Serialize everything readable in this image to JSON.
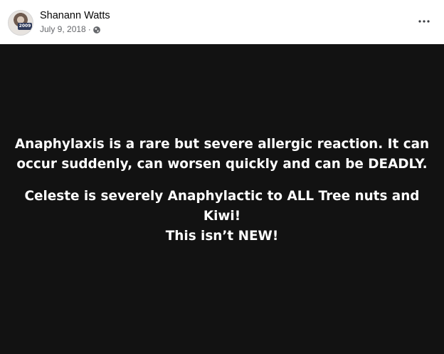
{
  "post": {
    "author": "Shanann Watts",
    "date": "July 9, 2018",
    "separator": "·",
    "privacy_icon": "globe-icon",
    "more_icon": "more-horizontal-icon",
    "avatar_sign_text": "2009",
    "background_color": "#121212",
    "text_color": "#ffffff"
  },
  "media": {
    "paragraph_1": "Anaphylaxis is a rare but severe allergic reaction. It can occur suddenly, can worsen quickly and can be DEADLY.",
    "paragraph_2_line_1": "Celeste is severely Anaphylactic to ALL Tree nuts and Kiwi!",
    "paragraph_2_line_2": "This isn’t NEW!"
  }
}
